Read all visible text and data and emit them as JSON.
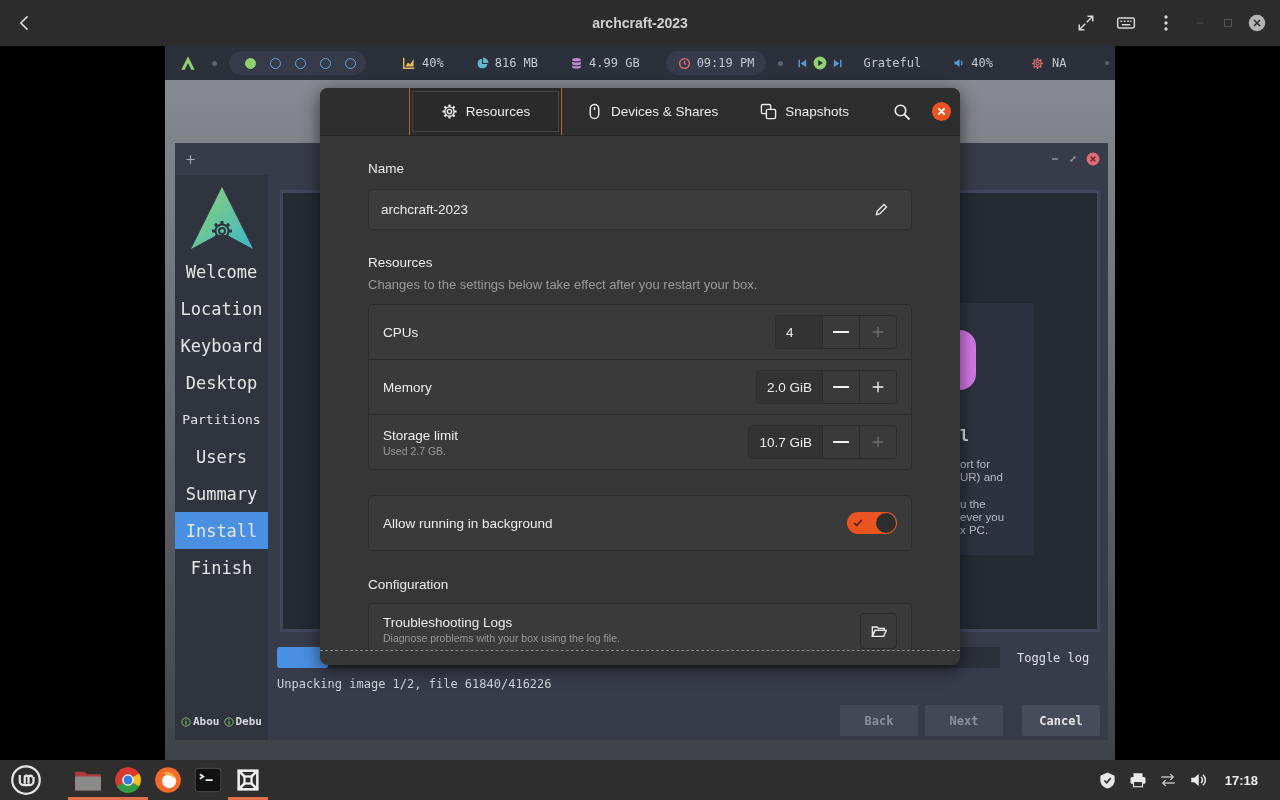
{
  "window": {
    "title": "archcraft-2023"
  },
  "polybar": {
    "workspaces": [
      {
        "selected": true
      },
      {
        "selected": false
      },
      {
        "selected": false
      },
      {
        "selected": false
      },
      {
        "selected": false
      }
    ],
    "cpu": "40%",
    "memory": "816 MB",
    "disk": "4.99 GB",
    "time": "09:19 PM",
    "song": "Grateful",
    "volume": "40%",
    "network": "NA"
  },
  "installer": {
    "nav": [
      {
        "label": "Welcome",
        "selected": false
      },
      {
        "label": "Location",
        "selected": false
      },
      {
        "label": "Keyboard",
        "selected": false
      },
      {
        "label": "Desktop",
        "selected": false
      },
      {
        "label": "Partitions",
        "selected": false
      },
      {
        "label": "Users",
        "selected": false
      },
      {
        "label": "Summary",
        "selected": false
      },
      {
        "label": "Install",
        "selected": true
      },
      {
        "label": "Finish",
        "selected": false
      }
    ],
    "footer_links": [
      "Abou",
      "Debu"
    ],
    "welcome_card": {
      "heading": "l",
      "lines": [
        "ort for",
        "UR) and",
        "u the",
        "ever you",
        "x PC."
      ]
    },
    "progress": {
      "level": 0.07
    },
    "toggle_log": "Toggle log",
    "status": "Unpacking image 1/2, file 61840/416226",
    "buttons": [
      {
        "label": "Back",
        "disabled": true
      },
      {
        "label": "Next",
        "disabled": true
      },
      {
        "label": "Cancel",
        "disabled": false
      }
    ]
  },
  "dialog": {
    "tabs": [
      {
        "label": "Resources",
        "kind": "gear",
        "selected": true
      },
      {
        "label": "Devices & Shares",
        "kind": "mouse",
        "selected": false
      },
      {
        "label": "Snapshots",
        "kind": "copy",
        "selected": false
      }
    ],
    "name_label": "Name",
    "name_value": "archcraft-2023",
    "resources_heading": "Resources",
    "resources_note": "Changes to the settings below take effect after you restart your box.",
    "resources": [
      {
        "label": "CPUs",
        "value": "4",
        "plus_disabled": true
      },
      {
        "label": "Memory",
        "value": "2.0 GiB",
        "plus_disabled": false
      },
      {
        "label": "Storage limit",
        "sublabel": "Used 2.7 GB.",
        "value": "10.7 GiB",
        "plus_disabled": true
      }
    ],
    "background": {
      "label": "Allow running in background",
      "on": true
    },
    "configuration_heading": "Configuration",
    "logs": {
      "title": "Troubleshooting Logs",
      "subtitle": "Diagnose problems with your box using the log file."
    }
  },
  "taskbar": {
    "apps": [
      {
        "kind": "folder",
        "active": true
      },
      {
        "kind": "browser",
        "active": true
      },
      {
        "kind": "fox",
        "active": false
      },
      {
        "kind": "terminal",
        "active": false
      },
      {
        "kind": "boxes",
        "active": true
      }
    ],
    "clock": "17:18"
  }
}
